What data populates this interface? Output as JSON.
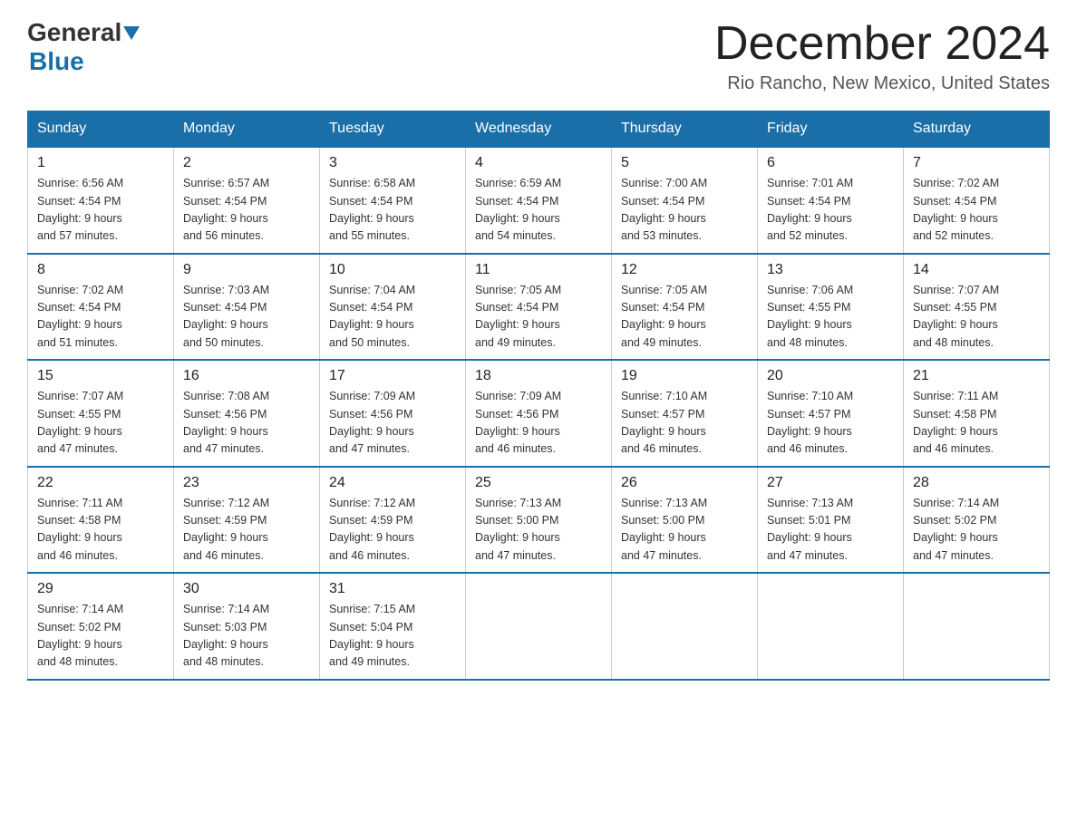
{
  "header": {
    "logo_general": "General",
    "logo_blue": "Blue",
    "month_title": "December 2024",
    "location": "Rio Rancho, New Mexico, United States"
  },
  "days_of_week": [
    "Sunday",
    "Monday",
    "Tuesday",
    "Wednesday",
    "Thursday",
    "Friday",
    "Saturday"
  ],
  "weeks": [
    [
      {
        "day": "1",
        "sunrise": "6:56 AM",
        "sunset": "4:54 PM",
        "daylight": "9 hours and 57 minutes."
      },
      {
        "day": "2",
        "sunrise": "6:57 AM",
        "sunset": "4:54 PM",
        "daylight": "9 hours and 56 minutes."
      },
      {
        "day": "3",
        "sunrise": "6:58 AM",
        "sunset": "4:54 PM",
        "daylight": "9 hours and 55 minutes."
      },
      {
        "day": "4",
        "sunrise": "6:59 AM",
        "sunset": "4:54 PM",
        "daylight": "9 hours and 54 minutes."
      },
      {
        "day": "5",
        "sunrise": "7:00 AM",
        "sunset": "4:54 PM",
        "daylight": "9 hours and 53 minutes."
      },
      {
        "day": "6",
        "sunrise": "7:01 AM",
        "sunset": "4:54 PM",
        "daylight": "9 hours and 52 minutes."
      },
      {
        "day": "7",
        "sunrise": "7:02 AM",
        "sunset": "4:54 PM",
        "daylight": "9 hours and 52 minutes."
      }
    ],
    [
      {
        "day": "8",
        "sunrise": "7:02 AM",
        "sunset": "4:54 PM",
        "daylight": "9 hours and 51 minutes."
      },
      {
        "day": "9",
        "sunrise": "7:03 AM",
        "sunset": "4:54 PM",
        "daylight": "9 hours and 50 minutes."
      },
      {
        "day": "10",
        "sunrise": "7:04 AM",
        "sunset": "4:54 PM",
        "daylight": "9 hours and 50 minutes."
      },
      {
        "day": "11",
        "sunrise": "7:05 AM",
        "sunset": "4:54 PM",
        "daylight": "9 hours and 49 minutes."
      },
      {
        "day": "12",
        "sunrise": "7:05 AM",
        "sunset": "4:54 PM",
        "daylight": "9 hours and 49 minutes."
      },
      {
        "day": "13",
        "sunrise": "7:06 AM",
        "sunset": "4:55 PM",
        "daylight": "9 hours and 48 minutes."
      },
      {
        "day": "14",
        "sunrise": "7:07 AM",
        "sunset": "4:55 PM",
        "daylight": "9 hours and 48 minutes."
      }
    ],
    [
      {
        "day": "15",
        "sunrise": "7:07 AM",
        "sunset": "4:55 PM",
        "daylight": "9 hours and 47 minutes."
      },
      {
        "day": "16",
        "sunrise": "7:08 AM",
        "sunset": "4:56 PM",
        "daylight": "9 hours and 47 minutes."
      },
      {
        "day": "17",
        "sunrise": "7:09 AM",
        "sunset": "4:56 PM",
        "daylight": "9 hours and 47 minutes."
      },
      {
        "day": "18",
        "sunrise": "7:09 AM",
        "sunset": "4:56 PM",
        "daylight": "9 hours and 46 minutes."
      },
      {
        "day": "19",
        "sunrise": "7:10 AM",
        "sunset": "4:57 PM",
        "daylight": "9 hours and 46 minutes."
      },
      {
        "day": "20",
        "sunrise": "7:10 AM",
        "sunset": "4:57 PM",
        "daylight": "9 hours and 46 minutes."
      },
      {
        "day": "21",
        "sunrise": "7:11 AM",
        "sunset": "4:58 PM",
        "daylight": "9 hours and 46 minutes."
      }
    ],
    [
      {
        "day": "22",
        "sunrise": "7:11 AM",
        "sunset": "4:58 PM",
        "daylight": "9 hours and 46 minutes."
      },
      {
        "day": "23",
        "sunrise": "7:12 AM",
        "sunset": "4:59 PM",
        "daylight": "9 hours and 46 minutes."
      },
      {
        "day": "24",
        "sunrise": "7:12 AM",
        "sunset": "4:59 PM",
        "daylight": "9 hours and 46 minutes."
      },
      {
        "day": "25",
        "sunrise": "7:13 AM",
        "sunset": "5:00 PM",
        "daylight": "9 hours and 47 minutes."
      },
      {
        "day": "26",
        "sunrise": "7:13 AM",
        "sunset": "5:00 PM",
        "daylight": "9 hours and 47 minutes."
      },
      {
        "day": "27",
        "sunrise": "7:13 AM",
        "sunset": "5:01 PM",
        "daylight": "9 hours and 47 minutes."
      },
      {
        "day": "28",
        "sunrise": "7:14 AM",
        "sunset": "5:02 PM",
        "daylight": "9 hours and 47 minutes."
      }
    ],
    [
      {
        "day": "29",
        "sunrise": "7:14 AM",
        "sunset": "5:02 PM",
        "daylight": "9 hours and 48 minutes."
      },
      {
        "day": "30",
        "sunrise": "7:14 AM",
        "sunset": "5:03 PM",
        "daylight": "9 hours and 48 minutes."
      },
      {
        "day": "31",
        "sunrise": "7:15 AM",
        "sunset": "5:04 PM",
        "daylight": "9 hours and 49 minutes."
      },
      null,
      null,
      null,
      null
    ]
  ],
  "labels": {
    "sunrise": "Sunrise:",
    "sunset": "Sunset:",
    "daylight": "Daylight:"
  }
}
